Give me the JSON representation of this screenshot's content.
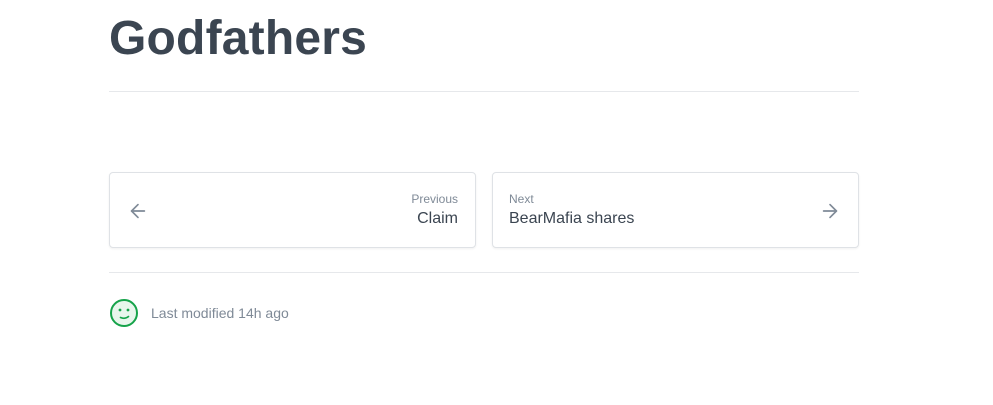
{
  "page": {
    "title": "Godfathers"
  },
  "pagination": {
    "previous": {
      "caption": "Previous",
      "target": "Claim",
      "icon": "arrow-left-icon"
    },
    "next": {
      "caption": "Next",
      "target": "BearMafia shares",
      "icon": "arrow-right-icon"
    }
  },
  "footer": {
    "modified_text": "Last modified 14h ago",
    "icon": "smiley-icon",
    "icon_color": "#16a34a"
  },
  "colors": {
    "text_primary": "#3b4551",
    "text_muted": "#7f8a97",
    "border": "#dfe2e6"
  }
}
